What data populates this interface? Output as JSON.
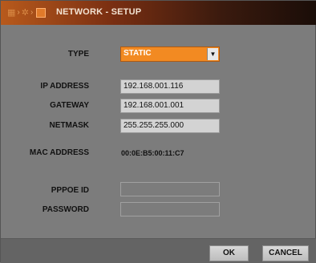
{
  "window": {
    "title": "NETWORK - SETUP"
  },
  "form": {
    "type": {
      "label": "TYPE",
      "value": "STATIC"
    },
    "ip_address": {
      "label": "IP ADDRESS",
      "value": "192.168.001.116"
    },
    "gateway": {
      "label": "GATEWAY",
      "value": "192.168.001.001"
    },
    "netmask": {
      "label": "NETMASK",
      "value": "255.255.255.000"
    },
    "mac_address": {
      "label": "MAC ADDRESS",
      "value": "00:0E:B5:00:11:C7"
    },
    "pppoe_id": {
      "label": "PPPOE ID",
      "value": ""
    },
    "password": {
      "label": "PASSWORD",
      "value": ""
    }
  },
  "buttons": {
    "ok": "OK",
    "cancel": "CANCEL"
  },
  "icons": [
    "grid-icon",
    "gear-icon",
    "network-icon",
    "dropdown-arrow-icon"
  ],
  "colors": {
    "accent": "#f28a22",
    "titlebar": "#7a2f12"
  }
}
